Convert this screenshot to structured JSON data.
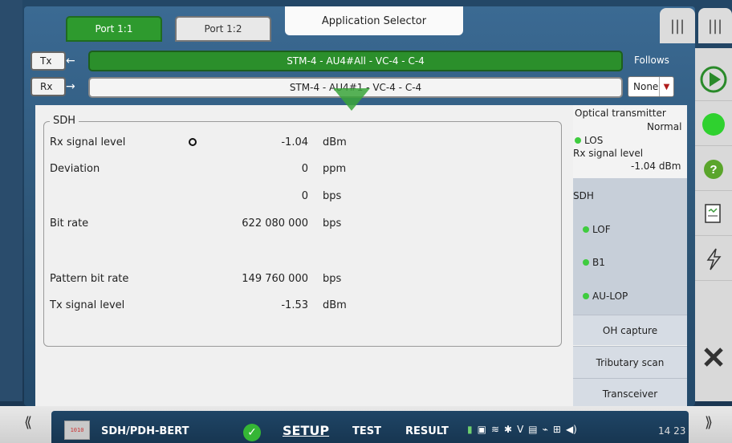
{
  "ports": [
    {
      "label": "Port 1:1",
      "active": true
    },
    {
      "label": "Port 1:2",
      "active": false
    }
  ],
  "app_selector": {
    "label": "Application Selector"
  },
  "tx": {
    "label": "Tx",
    "path": "STM-4 - AU4#All - VC-4 - C-4"
  },
  "rx": {
    "label": "Rx",
    "path": "STM-4 - AU4#1 - VC-4 - C-4"
  },
  "follows": {
    "label": "Follows",
    "value": "None"
  },
  "sdh": {
    "legend": "SDH",
    "rows": [
      {
        "label": "Rx signal level",
        "value": "-1.04",
        "unit": "dBm"
      },
      {
        "label": "Deviation",
        "value": "0",
        "unit": "ppm"
      },
      {
        "label": "",
        "value": "0",
        "unit": "bps"
      },
      {
        "label": "Bit rate",
        "value": "622 080 000",
        "unit": "bps"
      },
      {
        "label": "Pattern bit rate",
        "value": "149 760 000",
        "unit": "bps"
      },
      {
        "label": "Tx signal level",
        "value": "-1.53",
        "unit": "dBm"
      }
    ]
  },
  "status": {
    "optical_title": "Optical transmitter",
    "optical_state": "Normal",
    "los": "LOS",
    "rx_level_label": "Rx signal level",
    "rx_level_value": "-1.04 dBm",
    "sdh_title": "SDH",
    "alarms": [
      "LOF",
      "B1",
      "AU-LOP"
    ],
    "buttons": [
      "OH capture",
      "Tributary scan",
      "Transceiver"
    ]
  },
  "bottom": {
    "app_name": "SDH/PDH-BERT",
    "tabs": [
      "SETUP",
      "TEST",
      "RESULT"
    ],
    "time": "14 23"
  },
  "colors": {
    "accent_green": "#2e9a2e",
    "alarm_ok": "#3fcc3f"
  }
}
